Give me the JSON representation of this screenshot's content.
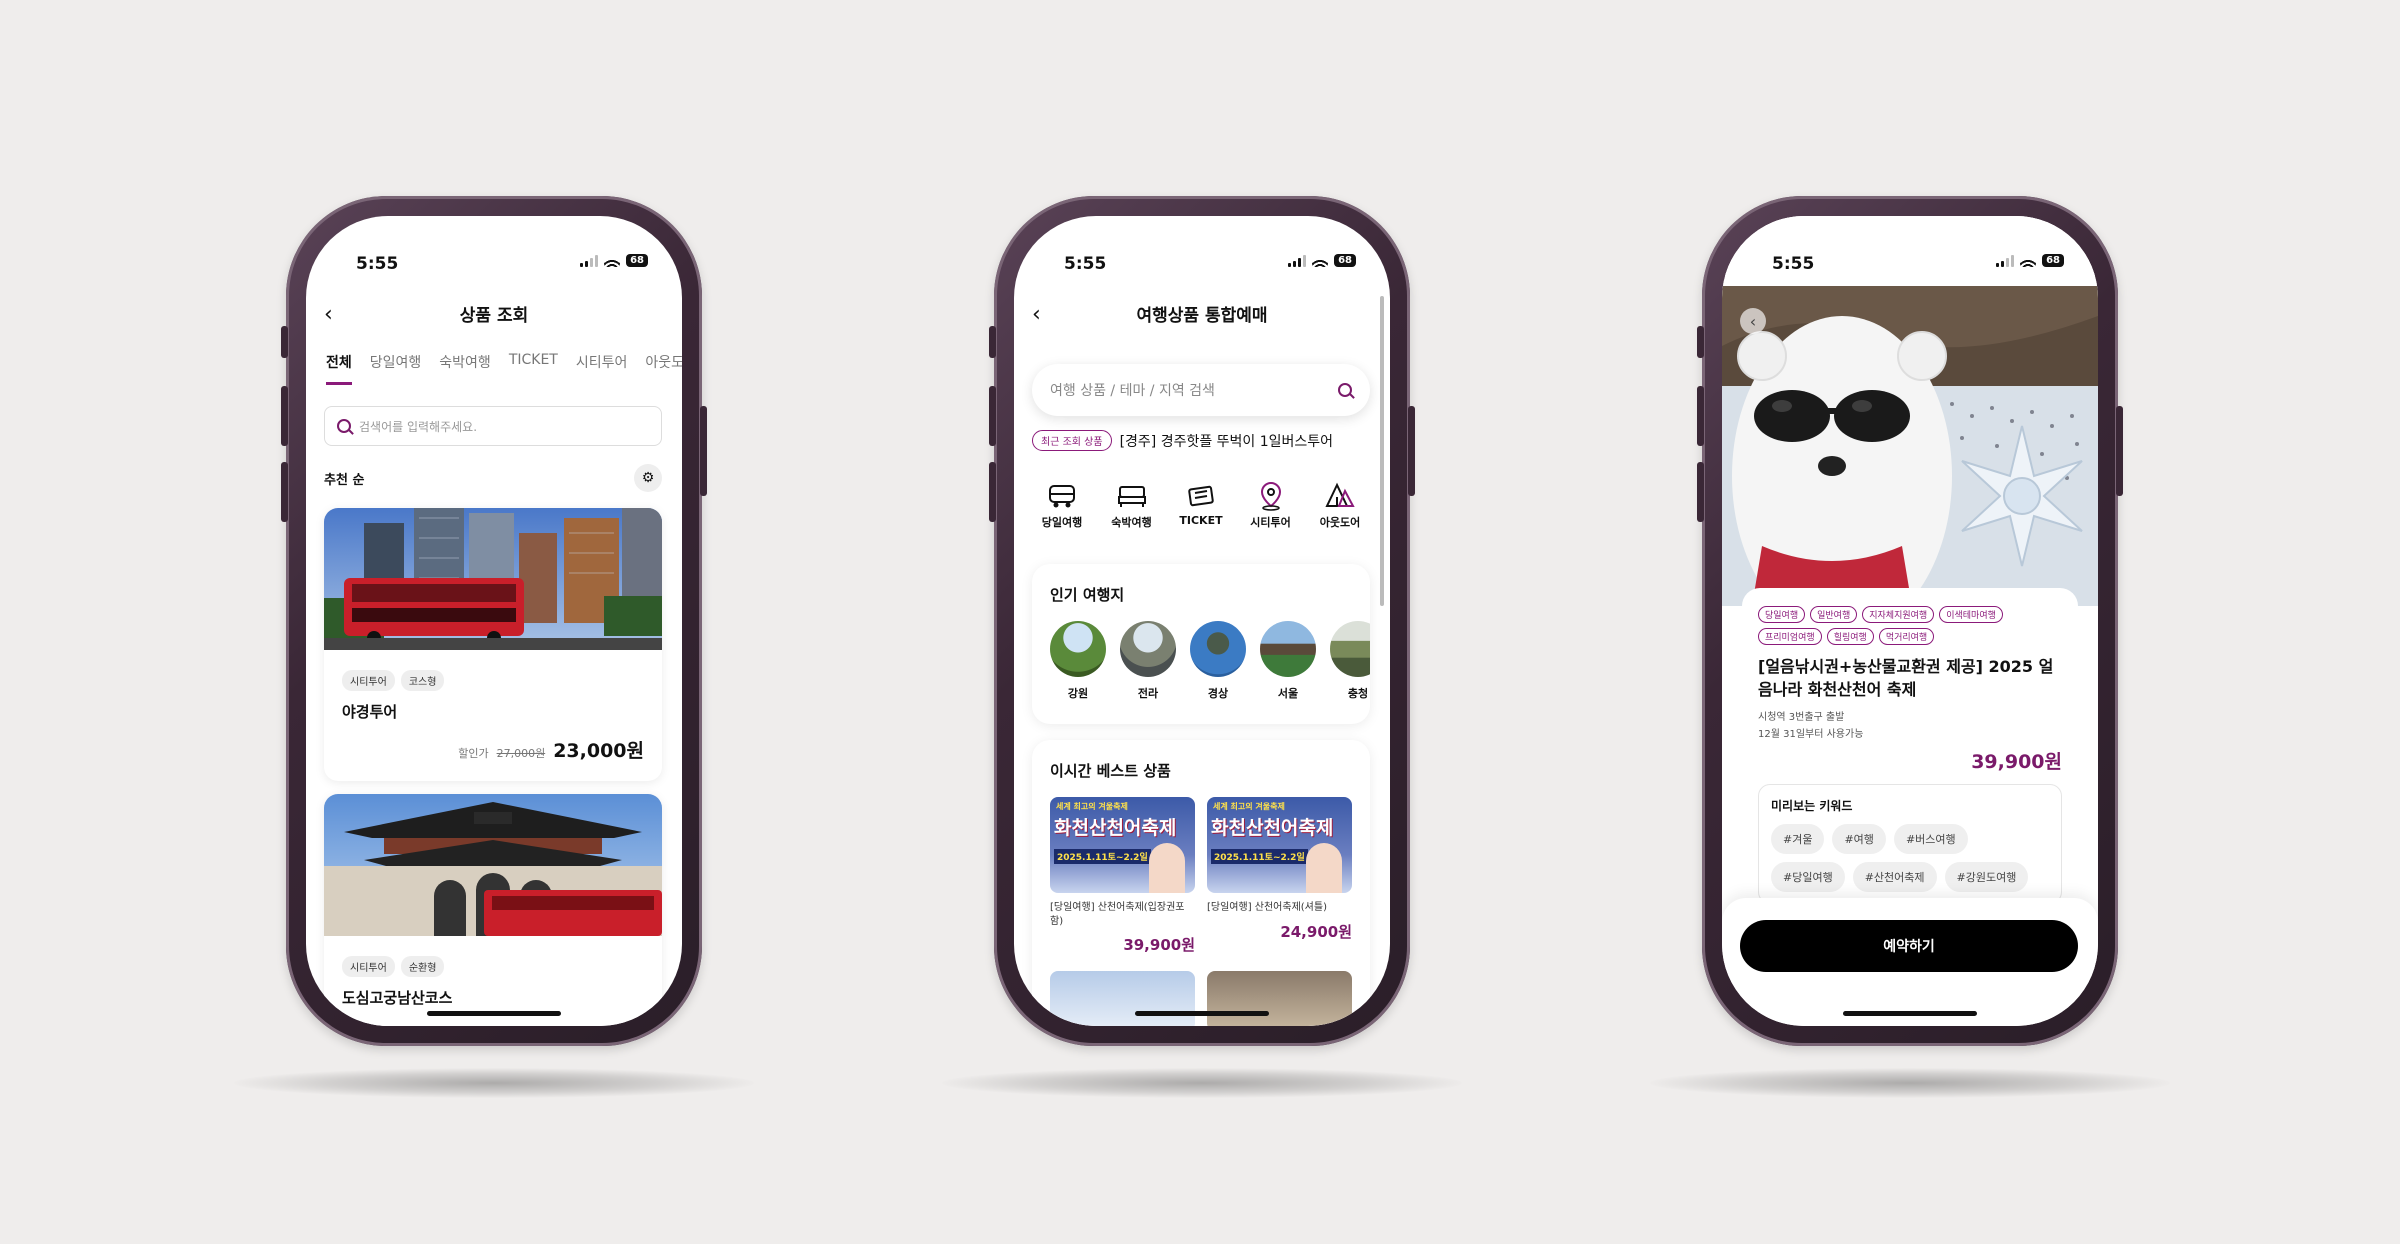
{
  "status": {
    "time": "5:55",
    "battery": "68"
  },
  "screen1": {
    "title": "상품 조회",
    "tabs": [
      "전체",
      "당일여행",
      "숙박여행",
      "TICKET",
      "시티투어",
      "아웃도"
    ],
    "search_placeholder": "검색어를 입력해주세요.",
    "sort_label": "추천 순",
    "cards": [
      {
        "tags": [
          "시티투어",
          "코스형"
        ],
        "name": "야경투어",
        "price_label": "할인가",
        "original_price": "27,000원",
        "price": "23,000원"
      },
      {
        "tags": [
          "시티투어",
          "순환형"
        ],
        "name": "도심고궁남산코스"
      }
    ]
  },
  "screen2": {
    "title": "여행상품 통합예매",
    "search_placeholder": "여행 상품 / 테마 / 지역 검색",
    "recent_badge": "최근 조회 상품",
    "recent_item": "[경주] 경주핫플 뚜벅이 1일버스투어",
    "categories": [
      {
        "label": "당일여행",
        "icon": "bus-icon"
      },
      {
        "label": "숙박여행",
        "icon": "bed-icon"
      },
      {
        "label": "TICKET",
        "icon": "ticket-icon"
      },
      {
        "label": "시티투어",
        "icon": "map-pin-icon"
      },
      {
        "label": "아웃도어",
        "icon": "tent-icon"
      }
    ],
    "popular_title": "인기 여행지",
    "destinations": [
      "강원",
      "전라",
      "경상",
      "서울",
      "충청"
    ],
    "best_title": "이시간 베스트 상품",
    "best_items": [
      {
        "caption": "[당일여행] 산천어축제(입장권포함)",
        "price": "39,900원",
        "poster_title": "화천산천어축제",
        "poster_sub": "세계 최고의 겨울축제",
        "poster_date": "2025.1.11토~2.2일"
      },
      {
        "caption": "[당일여행] 산천어축제(셔틀)",
        "price": "24,900원",
        "poster_title": "화천산천어축제",
        "poster_sub": "세계 최고의 겨울축제",
        "poster_date": "2025.1.11토~2.2일"
      }
    ]
  },
  "screen3": {
    "tags": [
      "당일여행",
      "일반여행",
      "지자체지원여행",
      "이색테마여행",
      "프리미엄여행",
      "힐링여행",
      "먹거리여행"
    ],
    "title": "[얼음낚시권+농산물교환권 제공] 2025 얼음나라 화천산천어 축제",
    "meta": [
      "시청역 3번출구 출발",
      "12월 31일부터 사용가능"
    ],
    "price": "39,900원",
    "keywords_title": "미리보는 키워드",
    "keywords": [
      "#겨울",
      "#여행",
      "#버스여행",
      "#당일여행",
      "#산천어축제",
      "#강원도여행"
    ],
    "reserve_label": "예약하기"
  },
  "colors": {
    "accent": "#8b1a7a",
    "price": "#7a1a6a",
    "background": "#efedec"
  }
}
